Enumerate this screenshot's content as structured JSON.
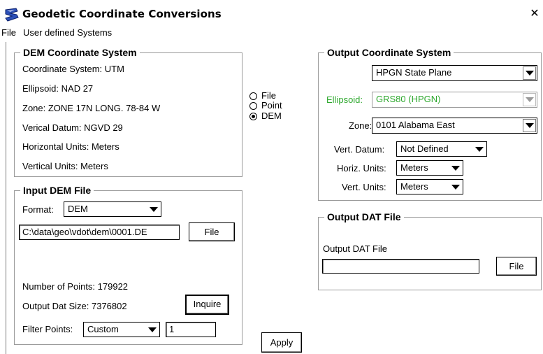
{
  "window": {
    "title": "Geodetic Coordinate Conversions",
    "close_glyph": "✕"
  },
  "menu": [
    "File",
    "User defined Systems"
  ],
  "dem_system": {
    "title": "DEM Coordinate System",
    "lines": [
      "Coordinate System: UTM",
      "Ellipsoid: NAD 27",
      "Zone: ZONE 17N LONG.  78-84 W",
      "Verical Datum: NGVD 29",
      "Horizontal Units: Meters",
      "Vertical Units: Meters"
    ]
  },
  "source_radio": {
    "options": [
      "File",
      "Point",
      "DEM"
    ],
    "selected": "DEM"
  },
  "input_dem": {
    "title": "Input DEM File",
    "format_label": "Format:",
    "format_value": "DEM",
    "path_value": "C:\\data\\geo\\vdot\\dem\\0001.DE",
    "file_button": "File",
    "num_points": "Number of Points: 179922",
    "output_size": "Output Dat Size: 7376802",
    "inquire_button": "Inquire",
    "filter_label": "Filter Points:",
    "filter_value": "Custom",
    "filter_amount": "1"
  },
  "apply_button": "Apply",
  "output_system": {
    "title": "Output Coordinate System",
    "system_value": "HPGN State Plane",
    "ellipsoid_label": "Ellipsoid:",
    "ellipsoid_value": "GRS80 (HPGN)",
    "zone_label": "Zone:",
    "zone_value": "0101 Alabama East",
    "vert_datum_label": "Vert. Datum:",
    "vert_datum_value": "Not Defined",
    "horiz_units_label": "Horiz. Units:",
    "horiz_units_value": "Meters",
    "vert_units_label": "Vert. Units:",
    "vert_units_value": "Meters",
    "accent_color": "#2ea82e"
  },
  "output_dat": {
    "title": "Output DAT File",
    "field_label": "Output DAT File",
    "field_value": "",
    "file_button": "File"
  },
  "icons": {
    "app": "geopak-logo-icon",
    "close": "close-icon",
    "dropdown": "chevron-down-icon"
  }
}
